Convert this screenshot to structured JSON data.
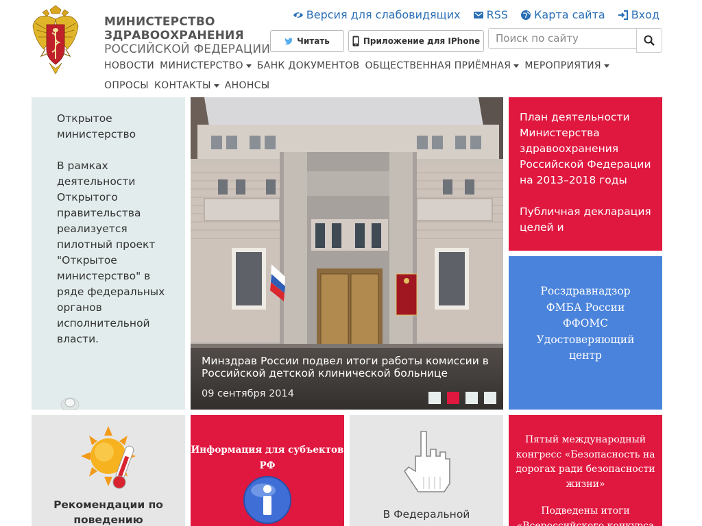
{
  "header": {
    "brand_line1": "МИНИСТЕРСТВО",
    "brand_line2": "ЗДРАВООХРАНЕНИЯ",
    "brand_line3": "РОССИЙСКОЙ ФЕДЕРАЦИИ",
    "logo_icon": "coat-of-arms-icon",
    "links": [
      {
        "label": "Версия для слабовидящих",
        "icon": "eye-icon"
      },
      {
        "label": "RSS",
        "icon": "rss-icon"
      },
      {
        "label": "Карта сайта",
        "icon": "globe-icon"
      },
      {
        "label": "Вход",
        "icon": "login-icon"
      }
    ],
    "read_button": "Читать",
    "iphone_button": "Приложение для IPhone",
    "search_placeholder": "Поиск по сайту"
  },
  "nav": {
    "row1": [
      {
        "label": "НОВОСТИ",
        "dropdown": false
      },
      {
        "label": "МИНИСТЕРСТВО",
        "dropdown": true
      },
      {
        "label": "БАНК ДОКУМЕНТОВ",
        "dropdown": false
      },
      {
        "label": "ОБЩЕСТВЕННАЯ ПРИЁМНАЯ",
        "dropdown": true
      },
      {
        "label": "МЕРОПРИЯТИЯ",
        "dropdown": true
      }
    ],
    "row2": [
      {
        "label": "ОПРОСЫ",
        "dropdown": false
      },
      {
        "label": "КОНТАКТЫ",
        "dropdown": true
      },
      {
        "label": "АНОНСЫ",
        "dropdown": false
      }
    ]
  },
  "tiles": {
    "open_ministry": {
      "title": "Открытое министерство",
      "text": "В рамках деятельности Открытого правительства реализуется пилотный проект \"Открытое министерство\" в ряде федеральных органов исполнительной власти."
    },
    "slider": {
      "caption": "Минздрав России подвел итоги работы комиссии в Российской детской клинической больнице",
      "date": "09 сентября 2014",
      "slides": 4,
      "active_slide": 2
    },
    "plan": {
      "p1": "План деятельности Министерства здравоохранения Российской Федерации на 2013–2018 годы",
      "p2": "Публичная декларация целей и"
    },
    "agencies": [
      "Росздравнадзор",
      "ФМБА России",
      "ФФОМС",
      "Удостоверяющий центр"
    ],
    "recommendations": {
      "title": "Рекомендации по поведению",
      "icon": "sun-thermometer-icon"
    },
    "info": {
      "title": "Информация для субъектов РФ",
      "icon": "info-icon"
    },
    "federal": {
      "title": "В Федеральной",
      "icon": "pointer-hand-icon"
    },
    "congress": {
      "p1": "Пятый международный конгресс «Безопасность на дорогах ради безопасности жизни»",
      "p2": "Подведены итоги «Всероссийского конкурса"
    }
  },
  "colors": {
    "red": "#e0173f",
    "blue": "#4a83db",
    "link": "#2a6fb5",
    "pale": "#e3ecec"
  }
}
